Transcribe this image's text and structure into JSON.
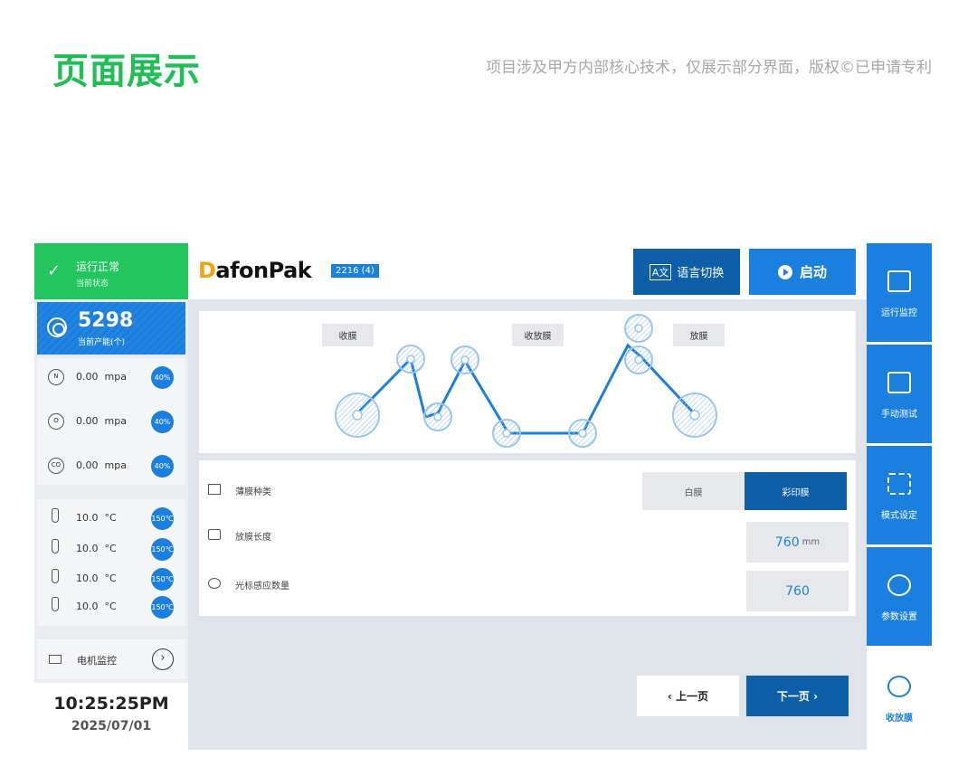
{
  "header": {
    "title": "页面展示",
    "note": "项目涉及甲方内部核心技术，仅展示部分界面，版权©已申请专利"
  },
  "status": {
    "label": "运行正常",
    "sub": "当前状态"
  },
  "production": {
    "count": "5298",
    "label": "当前产能(个)"
  },
  "gases": [
    {
      "symbol": "N",
      "value": "0.00",
      "unit": "mpa",
      "pct": "40%"
    },
    {
      "symbol": "O",
      "value": "0.00",
      "unit": "mpa",
      "pct": "40%"
    },
    {
      "symbol": "CO",
      "value": "0.00",
      "unit": "mpa",
      "pct": "40%"
    }
  ],
  "temps": [
    {
      "value": "10.0",
      "unit": "°C",
      "set": "150℃"
    },
    {
      "value": "10.0",
      "unit": "°C",
      "set": "150℃"
    },
    {
      "value": "10.0",
      "unit": "°C",
      "set": "150℃"
    },
    {
      "value": "10.0",
      "unit": "°C",
      "set": "150℃"
    }
  ],
  "motor": {
    "label": "电机监控"
  },
  "clock": {
    "time": "10:25:25PM",
    "date": "2025/07/01"
  },
  "brand": {
    "logo_d": "D",
    "logo_rest": "afonPak",
    "model": "2216 (4)"
  },
  "buttons": {
    "lang": "语言切换",
    "start": "启动",
    "prev": "上一页",
    "next": "下一页"
  },
  "diagram": {
    "tag_left": "收膜",
    "tag_mid": "收放膜",
    "tag_right": "放膜"
  },
  "params": {
    "film_type": {
      "label": "薄膜种类",
      "opt1": "白膜",
      "opt2": "彩印膜",
      "selected": "彩印膜"
    },
    "film_length": {
      "label": "放膜长度",
      "value": "760",
      "unit": "mm"
    },
    "cursor_count": {
      "label": "光标感应数量",
      "value": "760"
    }
  },
  "nav": [
    {
      "label": "运行监控",
      "icon": "monitor-icon"
    },
    {
      "label": "手动测试",
      "icon": "hand-icon"
    },
    {
      "label": "模式设定",
      "icon": "grid-icon"
    },
    {
      "label": "参数设置",
      "icon": "gear-icon"
    },
    {
      "label": "收放膜",
      "icon": "film-reel-icon",
      "active": true
    }
  ],
  "colors": {
    "brand_blue": "#1b7fe0",
    "dark_blue": "#0f5ea8",
    "green": "#22c55e",
    "title_green": "#1fbf55",
    "logo_orange": "#f4a312"
  }
}
